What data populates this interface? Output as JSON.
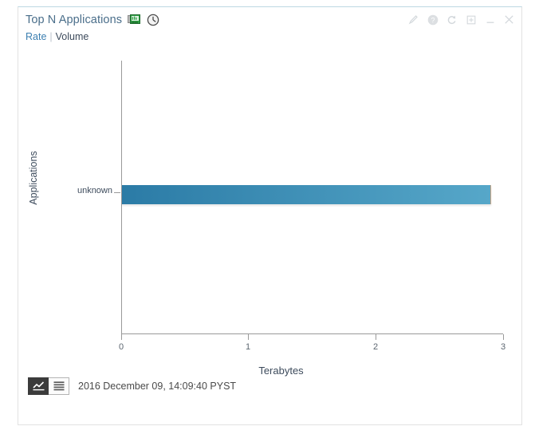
{
  "panel": {
    "title": "Top N Applications",
    "icons": [
      {
        "name": "network-card-icon",
        "label": "nic"
      },
      {
        "name": "clock-icon",
        "label": "clock"
      }
    ],
    "links": [
      {
        "label": "Rate",
        "active": true
      },
      {
        "label": "Volume",
        "active": false
      }
    ],
    "link_separator": "|"
  },
  "window_controls": [
    {
      "name": "edit-icon",
      "label": "Edit"
    },
    {
      "name": "help-icon",
      "label": "Help"
    },
    {
      "name": "refresh-icon",
      "label": "Refresh"
    },
    {
      "name": "maximize-icon",
      "label": "Maximize"
    },
    {
      "name": "minimize-icon",
      "label": "Minimize"
    },
    {
      "name": "close-icon",
      "label": "Close"
    }
  ],
  "footer": {
    "chart_view_button": "chart-view",
    "table_view_button": "table-view",
    "timestamp": "2016 December 09, 14:09:40 PYST"
  },
  "chart_data": {
    "type": "bar",
    "orientation": "horizontal",
    "title": "",
    "categories": [
      "unknown"
    ],
    "values": [
      2.9
    ],
    "xlabel": "Terabytes",
    "ylabel": "Applications",
    "xlim": [
      0,
      3
    ],
    "xticks": [
      0,
      1,
      2,
      3
    ],
    "xticklabels": [
      "0",
      "1",
      "2",
      "3"
    ],
    "grid": false,
    "legend": false,
    "bar_color_start": "#2b7ba6",
    "bar_color_end": "#56a7c9"
  }
}
